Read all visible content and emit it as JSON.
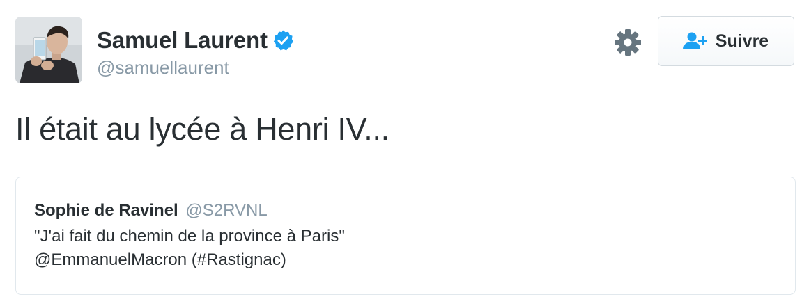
{
  "author": {
    "display_name": "Samuel Laurent",
    "handle": "@samuellaurent",
    "verified": true,
    "avatar_icon": "profile-photo"
  },
  "actions": {
    "settings_icon": "gear-icon",
    "follow_icon": "add-user-icon",
    "follow_label": "Suivre"
  },
  "tweet": {
    "text": "Il était au lycée à Henri IV..."
  },
  "quoted_tweet": {
    "display_name": "Sophie de Ravinel",
    "handle": "@S2RVNL",
    "line1": "\"J'ai fait du chemin de la province à Paris\"",
    "line2": "@EmmanuelMacron (#Rastignac)"
  },
  "colors": {
    "text": "#292f33",
    "muted": "#8899a6",
    "verified_blue": "#1da1f2",
    "border": "#e1e8ed"
  }
}
